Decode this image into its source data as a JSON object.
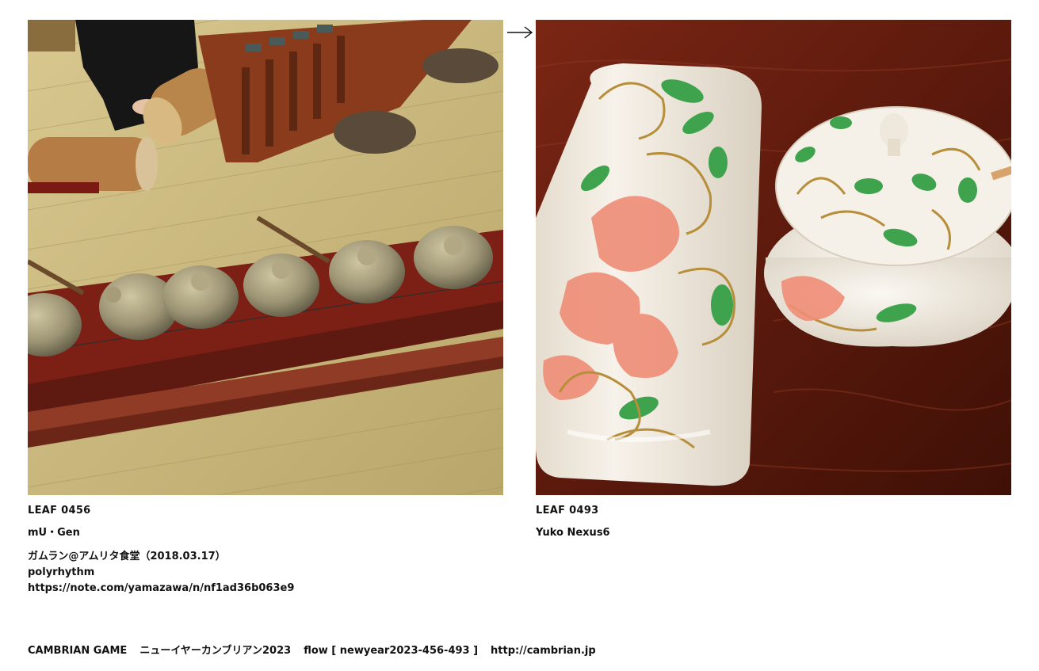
{
  "left_leaf": {
    "leaf_id": "LEAF 0456",
    "author": "mU・Gen",
    "description": [
      "ガムラン@アムリタ食堂（2018.03.17）",
      "polyrhythm",
      "https://note.com/yamazawa/n/nf1ad36b063e9"
    ],
    "photo_subject": "gamelan instruments on a wooden floor"
  },
  "right_leaf": {
    "leaf_id": "LEAF 0493",
    "author": "Yuko Nexus6",
    "photo_subject": "painted porcelain vase and lidded jar on a red lacquered table"
  },
  "arrow": {
    "icon": "arrow-right-icon",
    "glyph": "→"
  },
  "footer": {
    "game": "CAMBRIAN GAME",
    "event": "ニューイヤーカンブリアン2023",
    "flow": "flow [ newyear2023-456-493 ]",
    "url": "http://cambrian.jp"
  },
  "colors": {
    "text": "#111111",
    "background": "#ffffff",
    "floor": "#c9b97f",
    "lacquer": "#6e1d10",
    "porcelain": "#f1ebe0",
    "flower": "#ef8d77",
    "leaf_green": "#3fa34d",
    "gold": "#b78e3a"
  }
}
